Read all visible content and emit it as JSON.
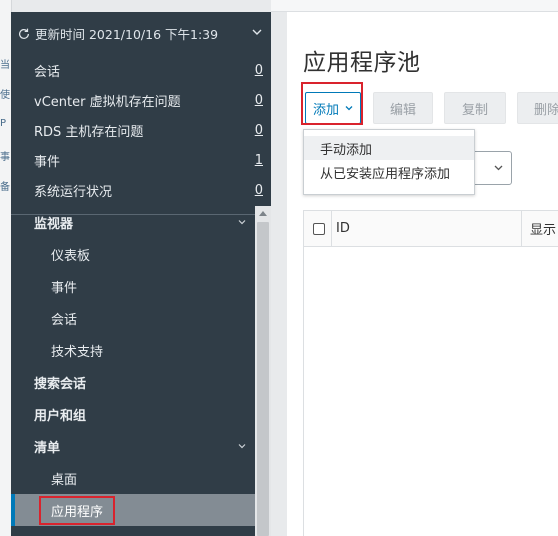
{
  "background": {
    "left_fragments": [
      "当",
      "使",
      "P",
      "事",
      "备"
    ]
  },
  "sidebar": {
    "updated_label": "更新时间 2021/10/16 下午1:39",
    "stats": [
      {
        "label": "会话",
        "count": "0"
      },
      {
        "label": "vCenter 虚拟机存在问题",
        "count": "0"
      },
      {
        "label": "RDS 主机存在问题",
        "count": "0"
      },
      {
        "label": "事件",
        "count": "1"
      },
      {
        "label": "系统运行状况",
        "count": "0"
      }
    ],
    "nav": {
      "monitor": "监视器",
      "dashboard": "仪表板",
      "events": "事件",
      "sessions": "会话",
      "support": "技术支持",
      "search_sessions": "搜索会话",
      "users_groups": "用户和组",
      "inventory": "清单",
      "desktops": "桌面",
      "applications": "应用程序"
    }
  },
  "main": {
    "title": "应用程序池",
    "toolbar": {
      "add": "添加",
      "edit": "编辑",
      "copy": "复制",
      "delete": "删除"
    },
    "add_menu": {
      "manual": "手动添加",
      "from_installed": "从已安装应用程序添加"
    },
    "grid": {
      "col_id": "ID",
      "col_display_name": "显示"
    }
  },
  "colors": {
    "sidebar_bg": "#303d47",
    "accent_blue": "#0079b8",
    "highlight_red": "#d9232d"
  }
}
